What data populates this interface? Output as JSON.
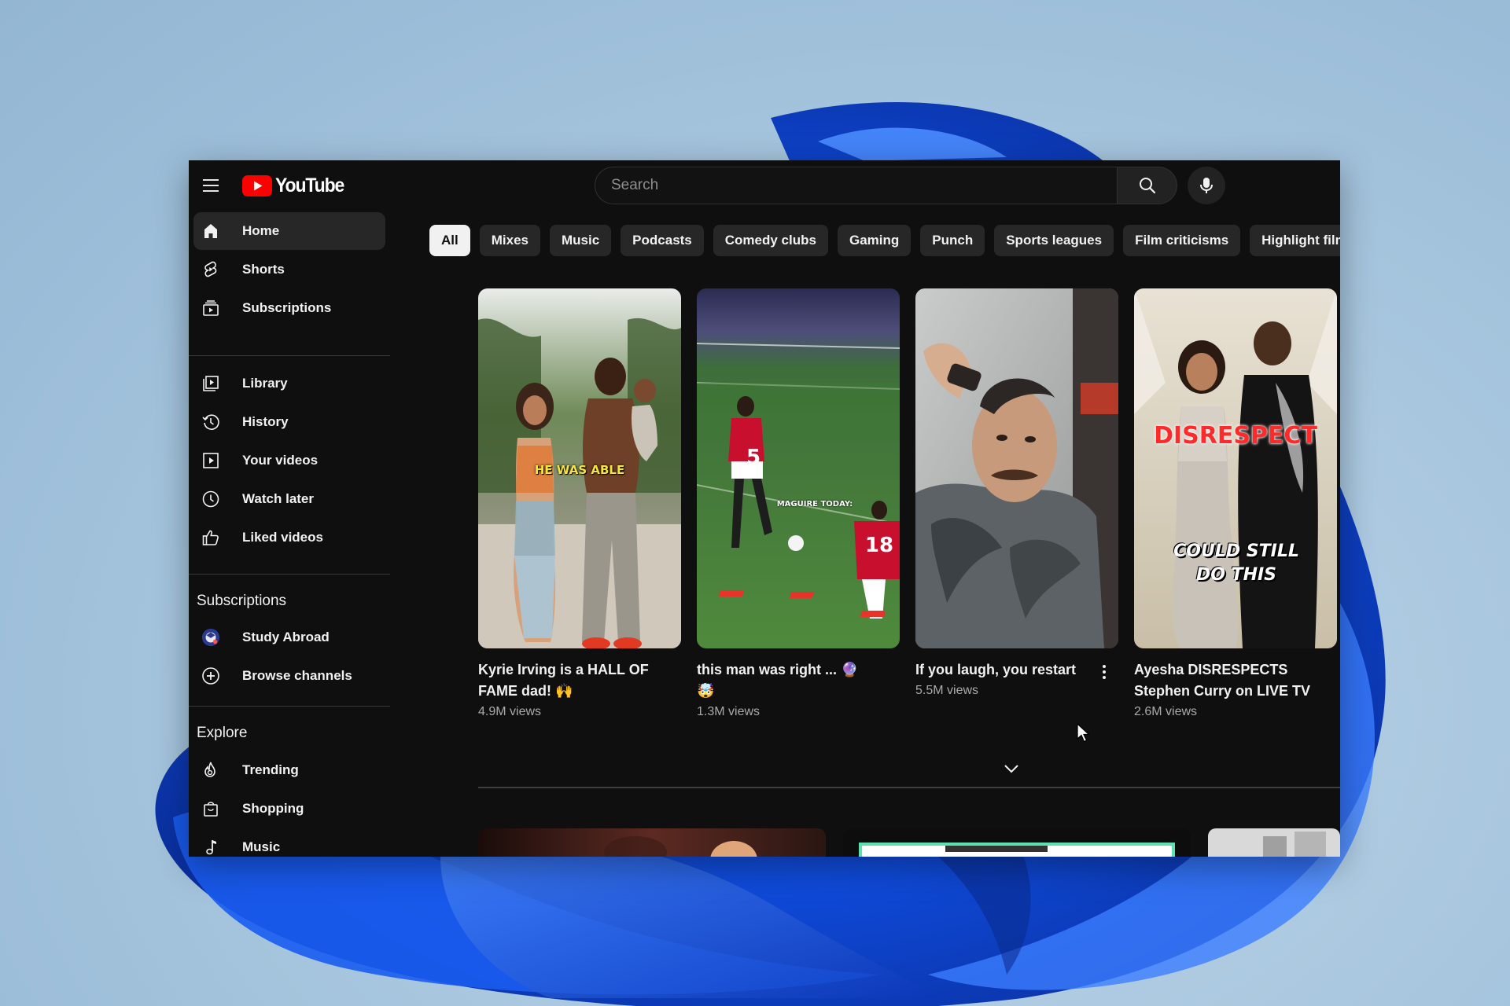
{
  "app": {
    "logo_text": "YouTube"
  },
  "header": {
    "search_placeholder": "Search"
  },
  "sidebar": {
    "primary": [
      {
        "label": "Home",
        "icon": "home-icon",
        "active": true
      },
      {
        "label": "Shorts",
        "icon": "shorts-icon",
        "active": false
      },
      {
        "label": "Subscriptions",
        "icon": "subscriptions-icon",
        "active": false
      }
    ],
    "you": [
      {
        "label": "Library",
        "icon": "library-icon"
      },
      {
        "label": "History",
        "icon": "history-icon"
      },
      {
        "label": "Your videos",
        "icon": "your-videos-icon"
      },
      {
        "label": "Watch later",
        "icon": "watch-later-icon"
      },
      {
        "label": "Liked videos",
        "icon": "liked-videos-icon"
      }
    ],
    "subscriptions_title": "Subscriptions",
    "subscriptions": [
      {
        "label": "Study Abroad",
        "icon": "channel-avatar"
      },
      {
        "label": "Browse channels",
        "icon": "add-circle-icon"
      }
    ],
    "explore_title": "Explore",
    "explore": [
      {
        "label": "Trending",
        "icon": "trending-icon"
      },
      {
        "label": "Shopping",
        "icon": "shopping-bag-icon"
      },
      {
        "label": "Music",
        "icon": "music-note-icon"
      }
    ]
  },
  "chips": [
    {
      "label": "All",
      "active": true
    },
    {
      "label": "Mixes",
      "active": false
    },
    {
      "label": "Music",
      "active": false
    },
    {
      "label": "Podcasts",
      "active": false
    },
    {
      "label": "Comedy clubs",
      "active": false
    },
    {
      "label": "Gaming",
      "active": false
    },
    {
      "label": "Punch",
      "active": false
    },
    {
      "label": "Sports leagues",
      "active": false
    },
    {
      "label": "Film criticisms",
      "active": false
    },
    {
      "label": "Highlight films",
      "active": false
    }
  ],
  "shorts": [
    {
      "title": "Kyrie Irving is a HALL OF FAME dad! 🙌",
      "views": "4.9M views",
      "overlay": "HE WAS ABLE"
    },
    {
      "title": "this man was right ... 🔮 🤯",
      "views": "1.3M views",
      "overlay": "MAGUIRE TODAY:"
    },
    {
      "title": "If you laugh, you restart",
      "views": "5.5M views",
      "overlay": ""
    },
    {
      "title": "Ayesha DISRESPECTS Stephen Curry on LIVE TV",
      "views": "2.6M views",
      "overlay": "DISRESPECT",
      "overlay2": "COULD STILL DO THIS"
    }
  ],
  "jersey_numbers": [
    "5",
    "18"
  ],
  "colors": {
    "brand_red": "#ff0000",
    "background": "#0f0f0f",
    "chip_bg": "#272727",
    "text_secondary": "#aaaaaa"
  }
}
